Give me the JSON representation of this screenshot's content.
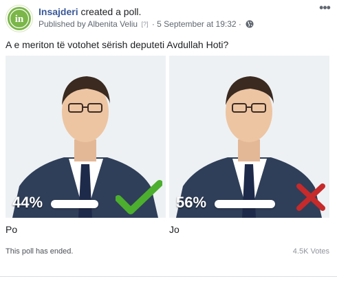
{
  "post": {
    "page_name": "Insajderi",
    "action_text": "created a poll.",
    "avatar_text": "in",
    "published_by": "Published by Albenita Veliu",
    "help_marker": "[?]",
    "separator": "·",
    "date": "5 September at 19:32",
    "privacy_icon": "globe-icon",
    "more_icon": "more-options-icon"
  },
  "poll": {
    "question": "A e meriton të votohet sërish deputeti Avdullah Hoti?",
    "options": [
      {
        "label": "Po",
        "percent_text": "44%",
        "percent": 44,
        "mark_icon": "checkmark-icon",
        "mark_color": "#4caf2e"
      },
      {
        "label": "Jo",
        "percent_text": "56%",
        "percent": 56,
        "mark_icon": "cross-icon",
        "mark_color": "#c62a2a"
      }
    ],
    "status": "This poll has ended.",
    "votes": "4.5K Votes"
  },
  "colors": {
    "page_name": "#385898",
    "brand_green": "#7ab648",
    "suit": "#2f3f59",
    "background": "#ffffff"
  }
}
